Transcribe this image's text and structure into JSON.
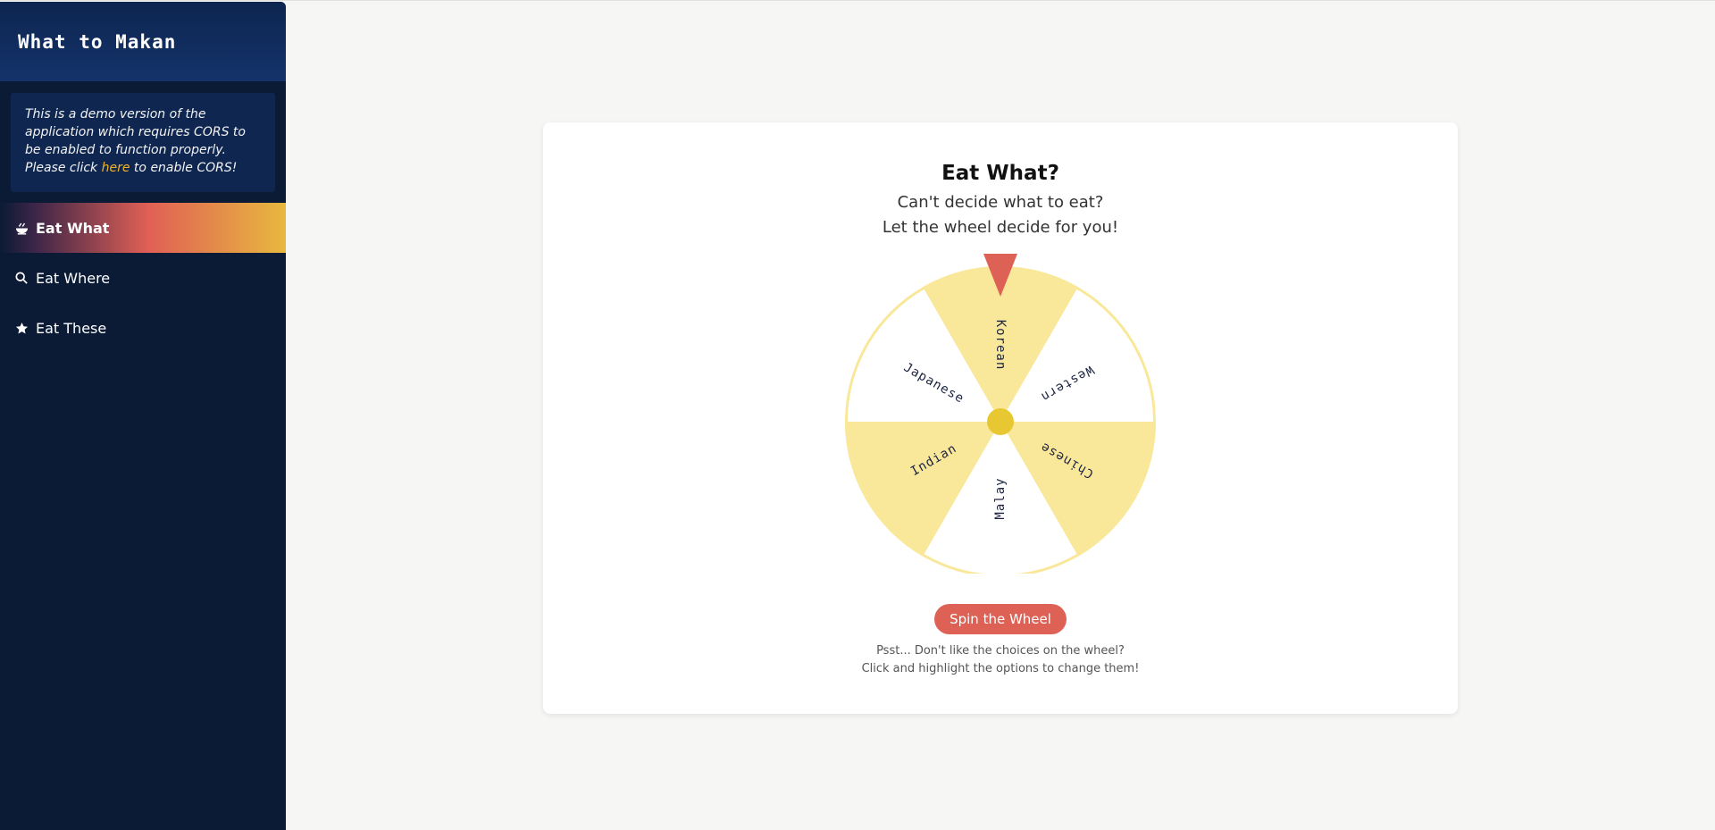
{
  "app": {
    "title": "What to Makan"
  },
  "notice": {
    "text_before": "This is a demo version of the application which requires CORS to be enabled to function properly. Please click ",
    "link_text": "here",
    "text_after": " to enable CORS!"
  },
  "nav": {
    "items": [
      {
        "label": "Eat What",
        "icon": "bowl-icon",
        "active": true
      },
      {
        "label": "Eat Where",
        "icon": "search-icon",
        "active": false
      },
      {
        "label": "Eat These",
        "icon": "star-icon",
        "active": false
      }
    ]
  },
  "main": {
    "title": "Eat What?",
    "subtitle_line1": "Can't decide what to eat?",
    "subtitle_line2": "Let the wheel decide for you!",
    "spin_label": "Spin the Wheel",
    "hint_line1": "Psst... Don't like the choices on the wheel?",
    "hint_line2": "Click and highlight the options to change them!"
  },
  "wheel": {
    "options": [
      "Korean",
      "Western",
      "Chinese",
      "Malay",
      "Indian",
      "Japanese"
    ],
    "colors": {
      "accent": "#f9e89a",
      "plain": "#ffffff",
      "border": "#f9e89a",
      "hub": "#e8c832",
      "pointer": "#de6156",
      "text": "#1b2340"
    }
  }
}
